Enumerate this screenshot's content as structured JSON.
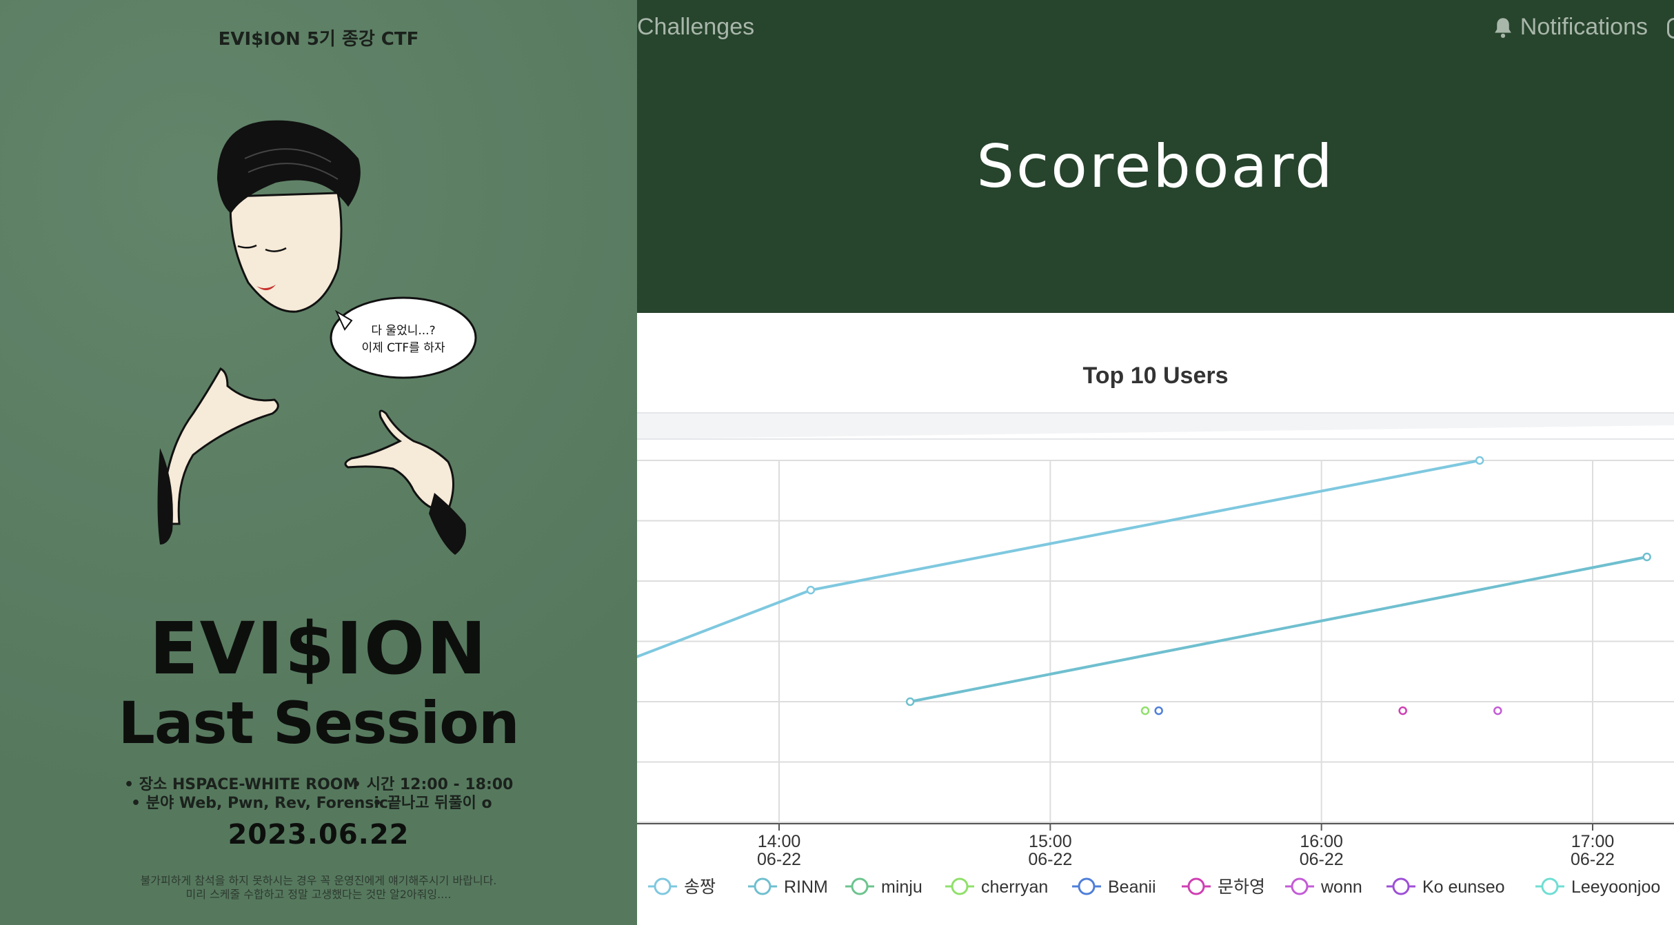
{
  "poster": {
    "header": "EVI$ION 5기 종강 CTF",
    "speech_bubble": [
      "다 울었니...?",
      "이제 CTF를 하자"
    ],
    "title": "EVI$ION",
    "subtitle": "Last Session",
    "info": {
      "place": "• 장소 HSPACE-WHITE ROOM",
      "time": "• 시간 12:00 - 18:00",
      "field": "• 분야 Web, Pwn, Rev, Forensic",
      "after": "• 끝나고 뒤풀이 o"
    },
    "date": "2023.06.22",
    "notes": [
      "불가피하게 참석을 하지 못하시는 경우 꼭 운영진에게 얘기해주시기 바랍니다.",
      "미리 스케줄 수합하고 정말 고생했다는 것만 알2아줘잉...."
    ]
  },
  "navbar": {
    "challenges": "Challenges",
    "notifications": "Notifications",
    "icons": {
      "notifications": "bell-icon"
    }
  },
  "page": {
    "title": "Scoreboard"
  },
  "colors": {
    "navbar_bg": "#27442d",
    "poster_bg": "#5a7e62"
  },
  "chart_data": {
    "type": "line",
    "title": "Top 10 Users",
    "x_ticks": [
      {
        "time": "14:00",
        "date": "06-22"
      },
      {
        "time": "15:00",
        "date": "06-22"
      },
      {
        "time": "16:00",
        "date": "06-22"
      },
      {
        "time": "17:00",
        "date": "06-22"
      }
    ],
    "ylim": [
      0,
      600
    ],
    "grid": true,
    "legend_position": "bottom",
    "series": [
      {
        "name": "송짱",
        "color": "#7ec8df",
        "points": [
          [
            "13:27",
            270
          ],
          [
            "14:07",
            385
          ],
          [
            "16:35",
            600
          ]
        ]
      },
      {
        "name": "RINM",
        "color": "#6fbfcf",
        "points": [
          [
            "14:29",
            200
          ],
          [
            "17:12",
            440
          ]
        ]
      },
      {
        "name": "minju",
        "color": "#6cc48e",
        "points": []
      },
      {
        "name": "cherryan",
        "color": "#8fe06a",
        "points": [
          [
            "15:21",
            185
          ]
        ]
      },
      {
        "name": "Beanii",
        "color": "#4f7fd8",
        "points": [
          [
            "15:24",
            185
          ]
        ]
      },
      {
        "name": "문하영",
        "color": "#cf3fb3",
        "points": [
          [
            "16:18",
            185
          ]
        ]
      },
      {
        "name": "wonn",
        "color": "#c35bd6",
        "points": [
          [
            "16:39",
            185
          ]
        ]
      },
      {
        "name": "Ko eunseo",
        "color": "#9d4fd6",
        "points": []
      },
      {
        "name": "Leeyoonjoo",
        "color": "#6fded3",
        "points": []
      }
    ]
  }
}
